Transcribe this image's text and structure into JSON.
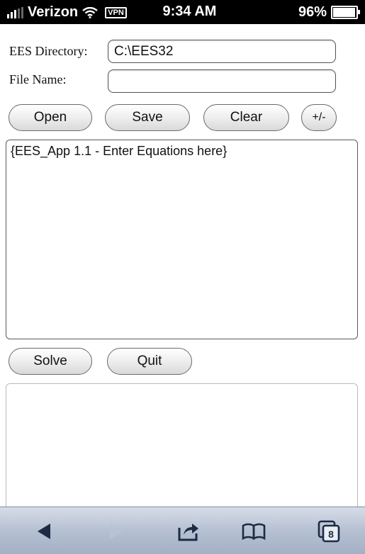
{
  "status_bar": {
    "carrier": "Verizon",
    "vpn": "VPN",
    "time": "9:34 AM",
    "battery": "96%",
    "battery_level": 0.96
  },
  "form": {
    "directory_label": "EES Directory:",
    "directory_value": "C:\\EES32",
    "filename_label": "File Name:",
    "filename_value": ""
  },
  "buttons": {
    "open": "Open",
    "save": "Save",
    "clear": "Clear",
    "toggle": "+/-",
    "solve": "Solve",
    "quit": "Quit"
  },
  "editor": {
    "content": "{EES_App 1.1 -  Enter Equations here}"
  },
  "output": {
    "content": ""
  },
  "toolbar": {
    "back": "back-icon",
    "forward": "forward-icon",
    "share": "share-icon",
    "bookmarks": "bookmarks-icon",
    "tabs_count": "8"
  }
}
